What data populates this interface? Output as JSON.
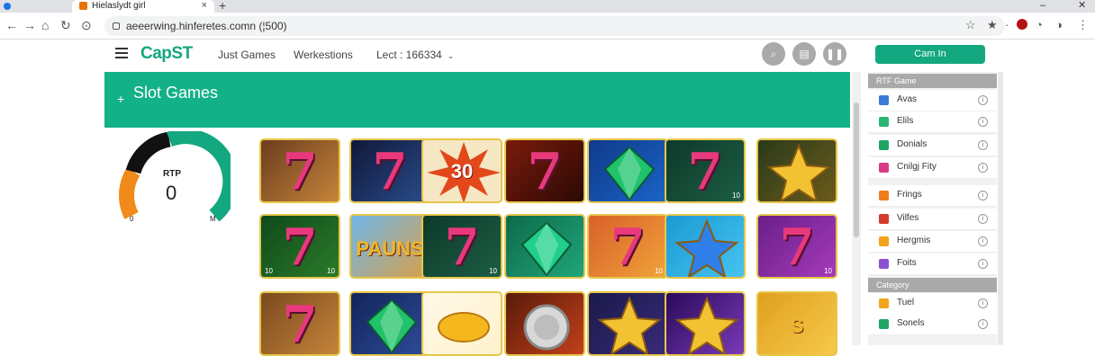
{
  "browser": {
    "tab_title": "Hielaslydt girl",
    "url": "aeeerwing.hinferetes.comn (¦500)"
  },
  "header": {
    "logo": "CapST",
    "nav": [
      "Just Games",
      "Werkestions",
      "Lect : 166334"
    ],
    "login_label": "Cam In"
  },
  "banner": {
    "title": "Slot Games"
  },
  "gauge": {
    "label": "RTP",
    "value": "0",
    "min": "0",
    "max": "M"
  },
  "sidebar": {
    "section1_title": "RTF Game",
    "items1": [
      {
        "label": "Avas",
        "color": "#3a7bd5"
      },
      {
        "label": "Elils",
        "color": "#2bb673"
      },
      {
        "label": "Donials",
        "color": "#1fa463"
      },
      {
        "label": "Cnilgj Fity",
        "color": "#d93a86"
      },
      {
        "label": "Frings",
        "color": "#f07d1a"
      },
      {
        "label": "Vilfes",
        "color": "#d23c2a"
      },
      {
        "label": "Hergmis",
        "color": "#f2a31b"
      },
      {
        "label": "Foits",
        "color": "#8c4fd1"
      }
    ],
    "section2_title": "Category",
    "items2": [
      {
        "label": "Tuel",
        "color": "#f0a51a"
      },
      {
        "label": "Sonels",
        "color": "#1fa463"
      }
    ]
  },
  "tiles": {
    "row1": [
      {
        "type": "seven",
        "left": "",
        "right": "",
        "bg": [
          "#6b3c1e",
          "#c5843a"
        ]
      },
      {
        "type": "seven",
        "left": "",
        "right": "",
        "bg": [
          "#10183a",
          "#2a4c8a"
        ]
      },
      {
        "type": "burst",
        "word": "30",
        "bg": [
          "#f6e7c4",
          "#f6e7c4"
        ]
      },
      {
        "type": "seven",
        "left": "",
        "right": "",
        "bg": [
          "#7a1a0a",
          "#2b0a06"
        ]
      },
      {
        "type": "gem",
        "left": "",
        "right": "",
        "gem": "#1ec36b",
        "bg": [
          "#0f3a8a",
          "#1b64c8"
        ]
      },
      {
        "type": "seven",
        "left": "",
        "right": "10",
        "bg": [
          "#0e3a2a",
          "#1c5d44"
        ]
      },
      {
        "type": "star",
        "left": "",
        "right": "",
        "bg": [
          "#2a3a1a",
          "#6b5a1a"
        ]
      }
    ],
    "row2": [
      {
        "type": "seven",
        "left": "10",
        "right": "10",
        "bg": [
          "#0f4a1a",
          "#2b7a2a"
        ]
      },
      {
        "type": "word",
        "word": "PAUNS",
        "left": "",
        "right": "",
        "bg": [
          "#6fb6e8",
          "#d9a04a"
        ]
      },
      {
        "type": "seven",
        "left": "",
        "right": "10",
        "bg": [
          "#0e3a2a",
          "#1c5d44"
        ]
      },
      {
        "type": "gem",
        "left": "",
        "right": "",
        "gem": "#1fcf8a",
        "bg": [
          "#0e6a4a",
          "#1fa57a"
        ]
      },
      {
        "type": "seven",
        "left": "",
        "right": "10",
        "bg": [
          "#d9602a",
          "#f0a33a"
        ]
      },
      {
        "type": "starblue",
        "left": "",
        "right": "",
        "bg": [
          "#1b9ad4",
          "#46c3ef"
        ]
      },
      {
        "type": "seven",
        "left": "",
        "right": "10",
        "bg": [
          "#6a1f8a",
          "#a43ab8"
        ]
      }
    ],
    "row3": [
      {
        "type": "seven",
        "left": "",
        "right": "",
        "bg": [
          "#7a4a1e",
          "#c5843a"
        ]
      },
      {
        "type": "gem",
        "left": "",
        "right": "",
        "gem": "#22c26a",
        "bg": [
          "#12245a",
          "#2e4c9a"
        ]
      },
      {
        "type": "lemon",
        "left": "",
        "right": "",
        "bg": [
          "#fff8e8",
          "#fff2cc"
        ]
      },
      {
        "type": "coin",
        "left": "",
        "right": "",
        "bg": [
          "#5a1a0a",
          "#c2401a"
        ]
      },
      {
        "type": "star",
        "left": "",
        "right": "",
        "bg": [
          "#1a1a4a",
          "#3a2a7a"
        ]
      },
      {
        "type": "star",
        "left": "",
        "right": "",
        "bg": [
          "#2a0a5a",
          "#7a3ab8"
        ]
      },
      {
        "type": "word",
        "word": "S",
        "left": "",
        "right": "",
        "bg": [
          "#e0a020",
          "#f7c94a"
        ]
      }
    ]
  }
}
